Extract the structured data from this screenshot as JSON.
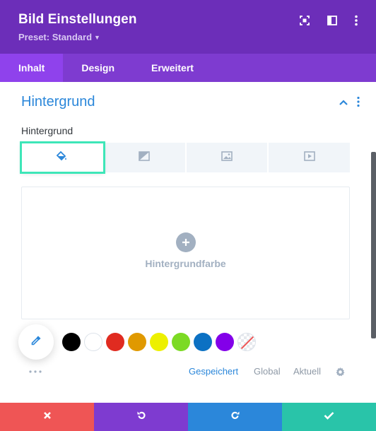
{
  "header": {
    "title": "Bild Einstellungen",
    "preset_label": "Preset: Standard",
    "icons": [
      "focus-icon",
      "sidebar-layout-icon",
      "more-vertical-icon"
    ],
    "color": "#6c2eb9"
  },
  "tabs": [
    {
      "label": "Inhalt",
      "active": true
    },
    {
      "label": "Design",
      "active": false
    },
    {
      "label": "Erweitert",
      "active": false
    }
  ],
  "section": {
    "title": "Hintergrund",
    "field_label": "Hintergrund",
    "background_types": [
      "paint-bucket-icon",
      "gradient-icon",
      "image-icon",
      "video-icon"
    ],
    "active_type": "paint-bucket-icon",
    "add_color_label": "Hintergrundfarbe"
  },
  "palette": {
    "swatches": [
      "#000000",
      "#ffffff",
      "#e02b20",
      "#e09900",
      "#edf000",
      "#7cda24",
      "#0c71c3",
      "#8300e9",
      "none"
    ],
    "tabs": [
      {
        "label": "Gespeichert",
        "active": true
      },
      {
        "label": "Global",
        "active": false
      },
      {
        "label": "Aktuell",
        "active": false
      }
    ]
  },
  "footer": {
    "buttons": [
      {
        "name": "cancel",
        "icon": "close-icon",
        "color": "#ef5555"
      },
      {
        "name": "undo",
        "icon": "undo-icon",
        "color": "#7e3bd0"
      },
      {
        "name": "redo",
        "icon": "redo-icon",
        "color": "#2b87da"
      },
      {
        "name": "save",
        "icon": "check-icon",
        "color": "#29c4a9"
      }
    ]
  },
  "colors": {
    "accent": "#2b87da",
    "tab_bar": "#7e3bd0",
    "active_tab": "#8f42ec",
    "highlight": "#3ee6b8",
    "muted": "#a2b0c1"
  }
}
